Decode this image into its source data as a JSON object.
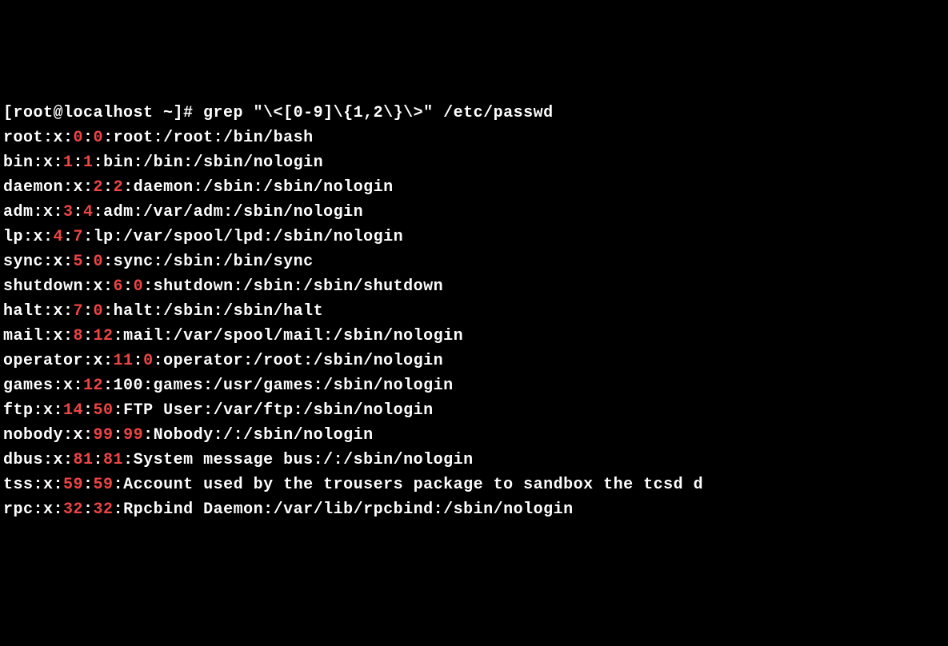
{
  "prompt": "[root@localhost ~]# ",
  "command": "grep \"\\<[0-9]\\{1,2\\}\\>\" /etc/passwd",
  "lines": [
    {
      "segments": [
        {
          "t": "root:x:",
          "h": false
        },
        {
          "t": "0",
          "h": true
        },
        {
          "t": ":",
          "h": false
        },
        {
          "t": "0",
          "h": true
        },
        {
          "t": ":root:/root:/bin/bash",
          "h": false
        }
      ]
    },
    {
      "segments": [
        {
          "t": "bin:x:",
          "h": false
        },
        {
          "t": "1",
          "h": true
        },
        {
          "t": ":",
          "h": false
        },
        {
          "t": "1",
          "h": true
        },
        {
          "t": ":bin:/bin:/sbin/nologin",
          "h": false
        }
      ]
    },
    {
      "segments": [
        {
          "t": "daemon:x:",
          "h": false
        },
        {
          "t": "2",
          "h": true
        },
        {
          "t": ":",
          "h": false
        },
        {
          "t": "2",
          "h": true
        },
        {
          "t": ":daemon:/sbin:/sbin/nologin",
          "h": false
        }
      ]
    },
    {
      "segments": [
        {
          "t": "adm:x:",
          "h": false
        },
        {
          "t": "3",
          "h": true
        },
        {
          "t": ":",
          "h": false
        },
        {
          "t": "4",
          "h": true
        },
        {
          "t": ":adm:/var/adm:/sbin/nologin",
          "h": false
        }
      ]
    },
    {
      "segments": [
        {
          "t": "lp:x:",
          "h": false
        },
        {
          "t": "4",
          "h": true
        },
        {
          "t": ":",
          "h": false
        },
        {
          "t": "7",
          "h": true
        },
        {
          "t": ":lp:/var/spool/lpd:/sbin/nologin",
          "h": false
        }
      ]
    },
    {
      "segments": [
        {
          "t": "sync:x:",
          "h": false
        },
        {
          "t": "5",
          "h": true
        },
        {
          "t": ":",
          "h": false
        },
        {
          "t": "0",
          "h": true
        },
        {
          "t": ":sync:/sbin:/bin/sync",
          "h": false
        }
      ]
    },
    {
      "segments": [
        {
          "t": "shutdown:x:",
          "h": false
        },
        {
          "t": "6",
          "h": true
        },
        {
          "t": ":",
          "h": false
        },
        {
          "t": "0",
          "h": true
        },
        {
          "t": ":shutdown:/sbin:/sbin/shutdown",
          "h": false
        }
      ]
    },
    {
      "segments": [
        {
          "t": "halt:x:",
          "h": false
        },
        {
          "t": "7",
          "h": true
        },
        {
          "t": ":",
          "h": false
        },
        {
          "t": "0",
          "h": true
        },
        {
          "t": ":halt:/sbin:/sbin/halt",
          "h": false
        }
      ]
    },
    {
      "segments": [
        {
          "t": "mail:x:",
          "h": false
        },
        {
          "t": "8",
          "h": true
        },
        {
          "t": ":",
          "h": false
        },
        {
          "t": "12",
          "h": true
        },
        {
          "t": ":mail:/var/spool/mail:/sbin/nologin",
          "h": false
        }
      ]
    },
    {
      "segments": [
        {
          "t": "operator:x:",
          "h": false
        },
        {
          "t": "11",
          "h": true
        },
        {
          "t": ":",
          "h": false
        },
        {
          "t": "0",
          "h": true
        },
        {
          "t": ":operator:/root:/sbin/nologin",
          "h": false
        }
      ]
    },
    {
      "segments": [
        {
          "t": "games:x:",
          "h": false
        },
        {
          "t": "12",
          "h": true
        },
        {
          "t": ":100:games:/usr/games:/sbin/nologin",
          "h": false
        }
      ]
    },
    {
      "segments": [
        {
          "t": "ftp:x:",
          "h": false
        },
        {
          "t": "14",
          "h": true
        },
        {
          "t": ":",
          "h": false
        },
        {
          "t": "50",
          "h": true
        },
        {
          "t": ":FTP User:/var/ftp:/sbin/nologin",
          "h": false
        }
      ]
    },
    {
      "segments": [
        {
          "t": "nobody:x:",
          "h": false
        },
        {
          "t": "99",
          "h": true
        },
        {
          "t": ":",
          "h": false
        },
        {
          "t": "99",
          "h": true
        },
        {
          "t": ":Nobody:/:/sbin/nologin",
          "h": false
        }
      ]
    },
    {
      "segments": [
        {
          "t": "dbus:x:",
          "h": false
        },
        {
          "t": "81",
          "h": true
        },
        {
          "t": ":",
          "h": false
        },
        {
          "t": "81",
          "h": true
        },
        {
          "t": ":System message bus:/:/sbin/nologin",
          "h": false
        }
      ]
    },
    {
      "segments": [
        {
          "t": "tss:x:",
          "h": false
        },
        {
          "t": "59",
          "h": true
        },
        {
          "t": ":",
          "h": false
        },
        {
          "t": "59",
          "h": true
        },
        {
          "t": ":Account used by the trousers package to sandbox the tcsd d",
          "h": false
        }
      ]
    },
    {
      "segments": [
        {
          "t": "rpc:x:",
          "h": false
        },
        {
          "t": "32",
          "h": true
        },
        {
          "t": ":",
          "h": false
        },
        {
          "t": "32",
          "h": true
        },
        {
          "t": ":Rpcbind Daemon:/var/lib/rpcbind:/sbin/nologin",
          "h": false
        }
      ]
    }
  ]
}
